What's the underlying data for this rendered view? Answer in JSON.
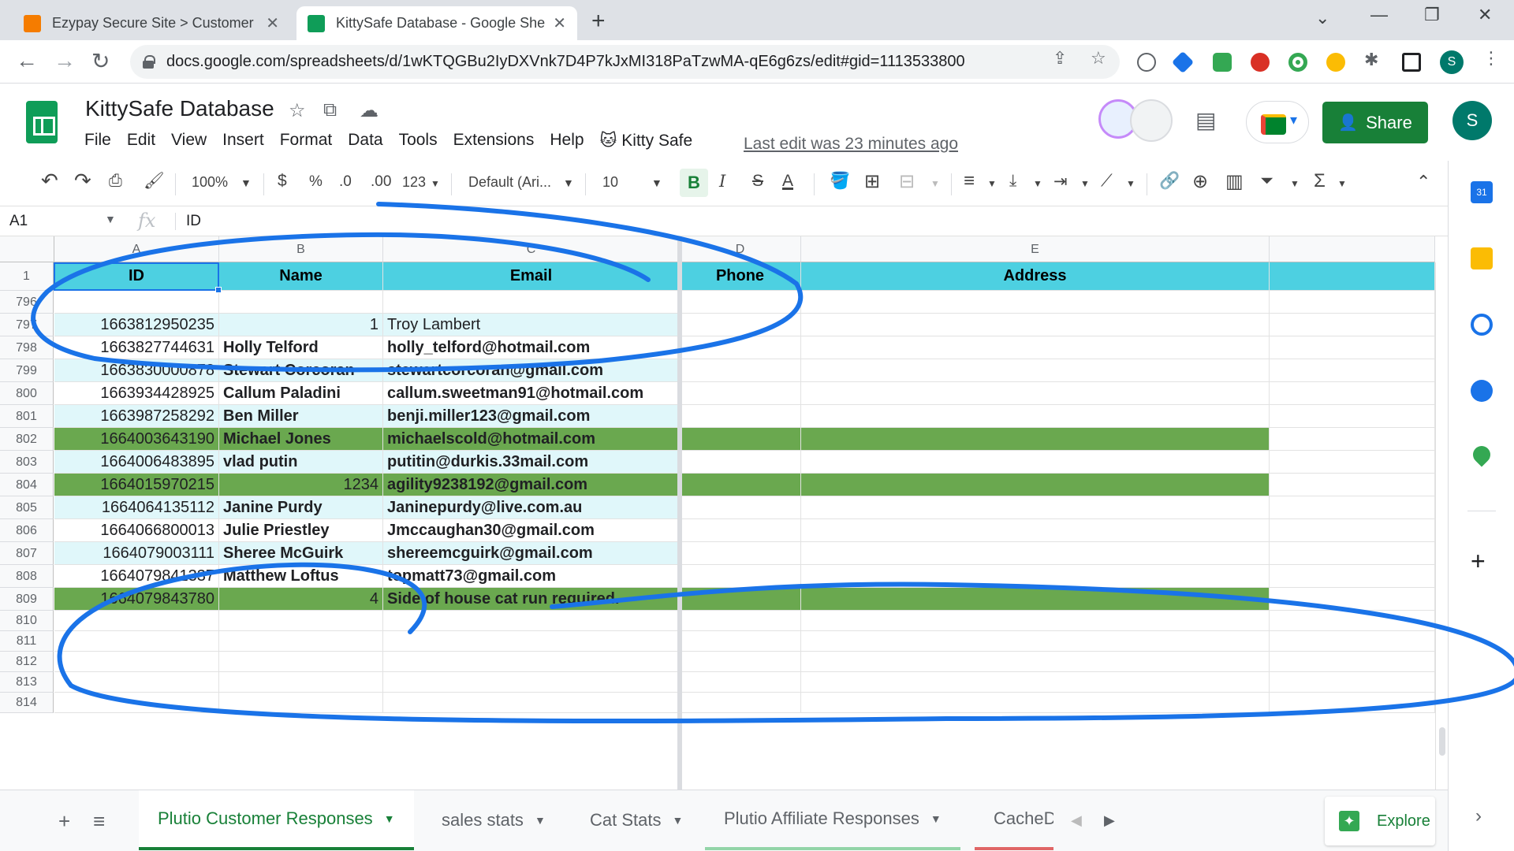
{
  "browser": {
    "tabs": [
      {
        "title": "Ezypay Secure Site > Customer",
        "active": false,
        "favicon_color": "#f57c00"
      },
      {
        "title": "KittySafe Database - Google Shee",
        "active": true,
        "favicon_color": "#0f9d58"
      }
    ],
    "url": "docs.google.com/spreadsheets/d/1wKTQGBu2IyDXVnk7D4P7kJxMI318PaTzwMA-qE6g6zs/edit#gid=1113533800",
    "profile_initial": "S"
  },
  "doc": {
    "title": "KittySafe Database",
    "menu": [
      "File",
      "Edit",
      "View",
      "Insert",
      "Format",
      "Data",
      "Tools",
      "Extensions",
      "Help",
      "🐱 Kitty Safe"
    ],
    "last_edit": "Last edit was 23 minutes ago",
    "share_label": "Share",
    "avatar_initial": "S"
  },
  "toolbar": {
    "zoom": "100%",
    "currency": "$",
    "percent": "%",
    "dec_decrease": ".0",
    "dec_increase": ".00",
    "format_more": "123",
    "font": "Default (Ari...",
    "font_size": "10",
    "bold": "B",
    "italic": "I",
    "strike": "S",
    "text_color": "A",
    "sum": "Σ"
  },
  "formula_bar": {
    "cell_ref": "A1",
    "fx": "fx",
    "value": "ID"
  },
  "grid": {
    "columns": [
      "A",
      "B",
      "C",
      "D",
      "E"
    ],
    "header_row": {
      "row_num": "1",
      "cells": [
        "ID",
        "Name",
        "Email",
        "Phone",
        "Address"
      ]
    },
    "rows": [
      {
        "row_num": "796",
        "id": "",
        "name": "",
        "email": "",
        "style": "white"
      },
      {
        "row_num": "797",
        "id": "1663812950235",
        "name": "1",
        "email": "Troy Lambert",
        "style": "light",
        "name_numeric": true,
        "email_plain": true
      },
      {
        "row_num": "798",
        "id": "1663827744631",
        "name": "Holly Telford",
        "email": "holly_telford@hotmail.com",
        "style": "white"
      },
      {
        "row_num": "799",
        "id": "1663830000878",
        "name": "Stewart Corcoran",
        "email": "stewartcorcoran@gmail.com",
        "style": "light"
      },
      {
        "row_num": "800",
        "id": "1663934428925",
        "name": "Callum Paladini",
        "email": "callum.sweetman91@hotmail.com",
        "style": "white"
      },
      {
        "row_num": "801",
        "id": "1663987258292",
        "name": "Ben Miller",
        "email": "benji.miller123@gmail.com",
        "style": "light"
      },
      {
        "row_num": "802",
        "id": "1664003643190",
        "name": "Michael Jones",
        "email": "michaelscold@hotmail.com",
        "style": "green"
      },
      {
        "row_num": "803",
        "id": "1664006483895",
        "name": "vlad putin",
        "email": "putitin@durkis.33mail.com",
        "style": "light"
      },
      {
        "row_num": "804",
        "id": "1664015970215",
        "name": "1234",
        "email": "agility9238192@gmail.com",
        "style": "green",
        "name_numeric": true
      },
      {
        "row_num": "805",
        "id": "1664064135112",
        "name": "Janine Purdy",
        "email": "Janinepurdy@live.com.au",
        "style": "light"
      },
      {
        "row_num": "806",
        "id": "1664066800013",
        "name": "Julie Priestley",
        "email": "Jmccaughan30@gmail.com",
        "style": "white"
      },
      {
        "row_num": "807",
        "id": "1664079003111",
        "name": "Sheree McGuirk",
        "email": "shereemcguirk@gmail.com",
        "style": "light"
      },
      {
        "row_num": "808",
        "id": "1664079841337",
        "name": "Matthew Loftus",
        "email": "topmatt73@gmail.com",
        "style": "white"
      },
      {
        "row_num": "809",
        "id": "1664079843780",
        "name": "4",
        "email": "Side of house cat run required.",
        "style": "green",
        "name_numeric": true
      },
      {
        "row_num": "810",
        "id": "",
        "name": "",
        "email": "",
        "style": "white"
      },
      {
        "row_num": "811",
        "id": "",
        "name": "",
        "email": "",
        "style": "white"
      },
      {
        "row_num": "812",
        "id": "",
        "name": "",
        "email": "",
        "style": "white"
      },
      {
        "row_num": "813",
        "id": "",
        "name": "",
        "email": "",
        "style": "white"
      },
      {
        "row_num": "814",
        "id": "",
        "name": "",
        "email": "",
        "style": "white"
      }
    ]
  },
  "colors": {
    "header_fill": "#4dd0e1",
    "light_fill": "#e0f7fa",
    "green_fill": "#6aa84f",
    "accent_green": "#188038",
    "annotation": "#1a73e8"
  },
  "sheet_tabs": [
    {
      "label": "Plutio Customer Responses",
      "active": true
    },
    {
      "label": "sales stats",
      "active": false
    },
    {
      "label": "Cat Stats",
      "active": false
    },
    {
      "label": "Plutio Affiliate Responses",
      "active": false
    },
    {
      "label": "CacheD",
      "active": false
    }
  ],
  "explore_label": "Explore"
}
